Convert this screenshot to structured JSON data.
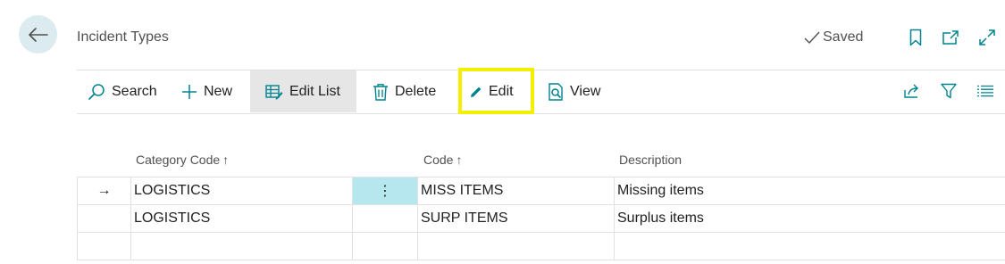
{
  "header": {
    "title": "Incident Types",
    "saved_label": "Saved"
  },
  "toolbar": {
    "search_label": "Search",
    "new_label": "New",
    "edit_list_label": "Edit List",
    "delete_label": "Delete",
    "edit_label": "Edit",
    "view_label": "View",
    "active_item": "Edit List",
    "highlighted_item": "Edit",
    "highlight_color": "#f2f000"
  },
  "table": {
    "columns": [
      "Category Code",
      "Code",
      "Description"
    ],
    "sort_indicators": [
      "↑",
      "↑",
      ""
    ],
    "rows": [
      {
        "category_code": "LOGISTICS",
        "code": "MISS ITEMS",
        "description": "Missing items",
        "selected": true
      },
      {
        "category_code": "LOGISTICS",
        "code": "SURP ITEMS",
        "description": "Surplus items",
        "selected": false
      },
      {
        "category_code": "",
        "code": "",
        "description": "",
        "selected": false
      }
    ],
    "selected_marker": "→",
    "row_menu_glyph": "⋮"
  },
  "colors": {
    "accent": "#00838f",
    "back_button_bg": "#dcebf0",
    "selected_cell_bg": "#b6e6ee"
  }
}
